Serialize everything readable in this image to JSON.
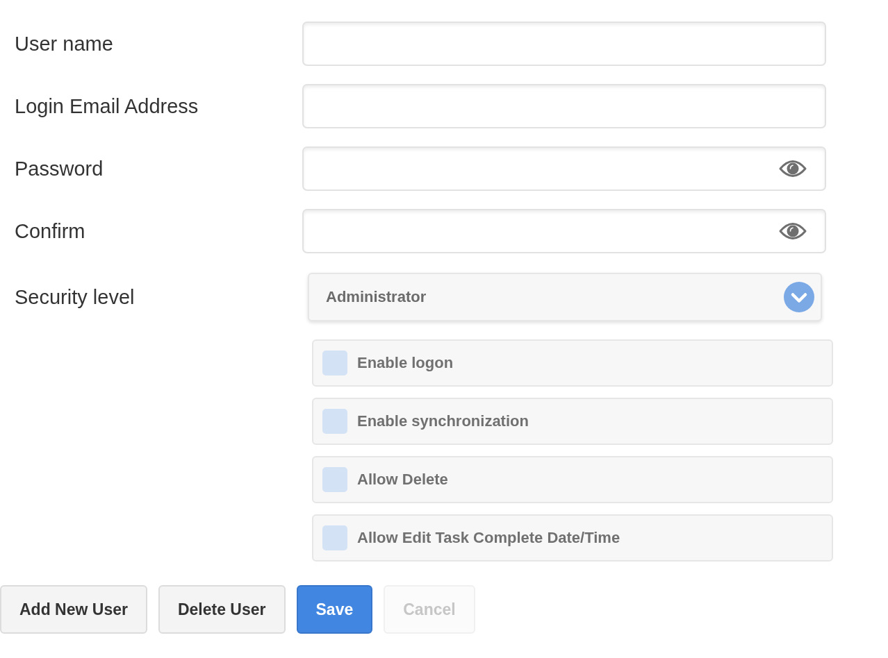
{
  "fields": [
    {
      "label": "User name",
      "kind": "text"
    },
    {
      "label": "Login Email Address",
      "kind": "text"
    },
    {
      "label": "Password",
      "kind": "password"
    },
    {
      "label": "Confirm",
      "kind": "password"
    }
  ],
  "security_level": {
    "label": "Security level",
    "value": "Administrator"
  },
  "options": [
    {
      "label": "Enable logon",
      "checked": false
    },
    {
      "label": "Enable synchronization",
      "checked": false
    },
    {
      "label": "Allow Delete",
      "checked": false
    },
    {
      "label": "Allow Edit Task Complete Date/Time",
      "checked": false
    }
  ],
  "buttons": [
    {
      "label": "Add New User",
      "kind": "default",
      "disabled": false
    },
    {
      "label": "Delete User",
      "kind": "default",
      "disabled": false
    },
    {
      "label": "Save",
      "kind": "primary",
      "disabled": false
    },
    {
      "label": "Cancel",
      "kind": "default",
      "disabled": true
    }
  ]
}
